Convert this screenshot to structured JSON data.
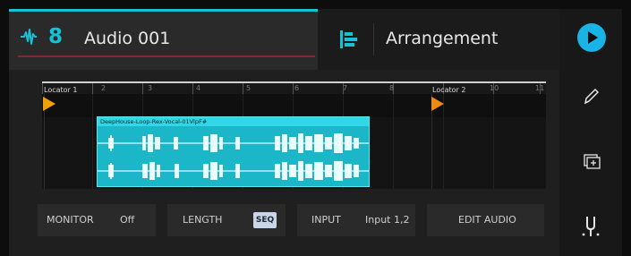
{
  "track": {
    "number": "8",
    "name": "Audio 001"
  },
  "view": {
    "label": "Arrangement"
  },
  "ruler": {
    "bars": [
      "2",
      "3",
      "4",
      "5",
      "6",
      "7",
      "8",
      "10",
      "11"
    ],
    "locator1": "Locator 1",
    "locator2": "Locator 2"
  },
  "clip": {
    "name": "DeepHouse-Loop-Rex-Vocal-01VlpF#"
  },
  "controls": {
    "monitor_label": "MONITOR",
    "monitor_value": "Off",
    "length_label": "LENGTH",
    "length_value": "SEQ",
    "input_label": "INPUT",
    "input_value": "Input 1,2",
    "edit_audio_label": "EDIT AUDIO"
  },
  "icons": {
    "track_type": "audio-waveform-icon",
    "view": "arrangement-icon",
    "play": "play-icon",
    "pencil": "pencil-icon",
    "duplicate": "duplicate-add-icon",
    "split": "split-icon"
  },
  "colors": {
    "accent": "#17c2d6",
    "play": "#1ab3e6",
    "locator": "#f0a000",
    "clip": "#1bb7c9"
  }
}
